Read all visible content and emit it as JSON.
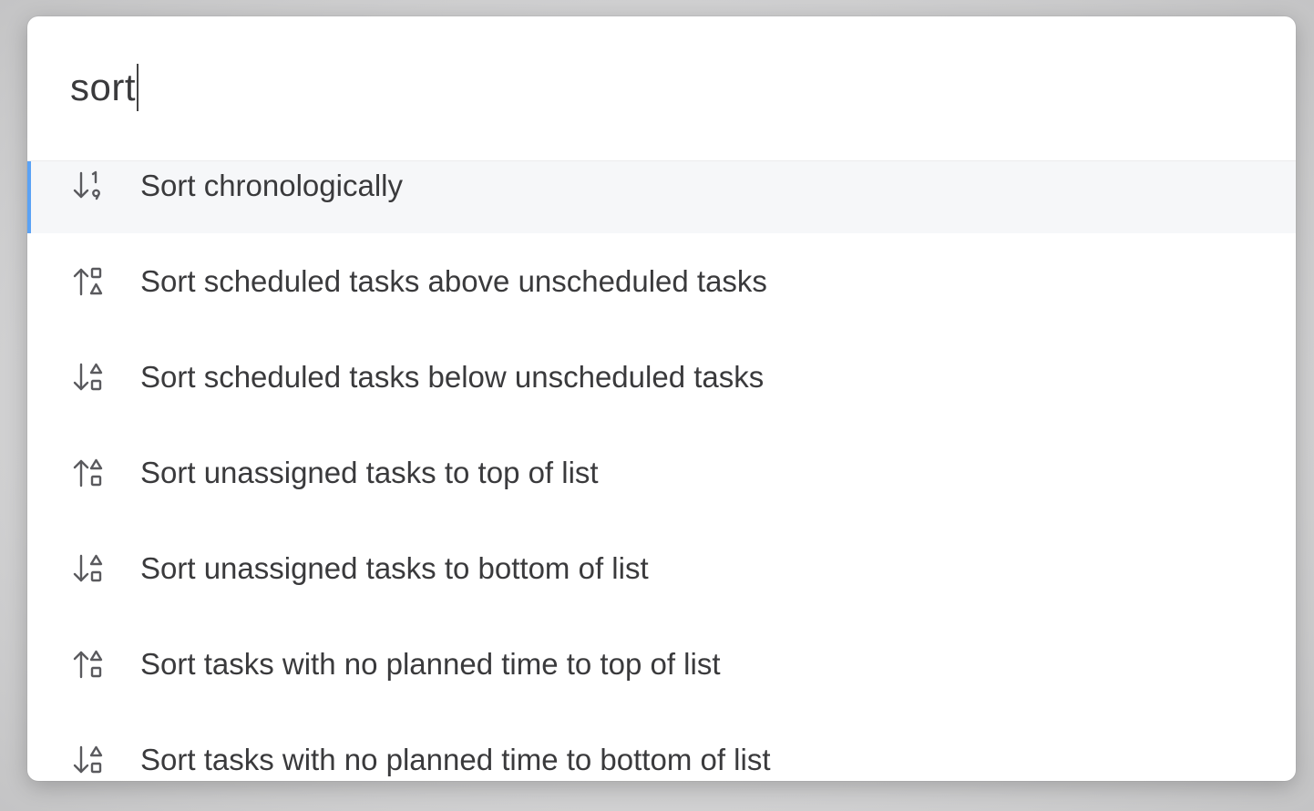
{
  "search": {
    "value": "sort"
  },
  "results": [
    {
      "label": "Sort chronologically",
      "icon": "sort-chronological-icon"
    },
    {
      "label": "Sort scheduled tasks above unscheduled tasks",
      "icon": "sort-up-shapes-icon"
    },
    {
      "label": "Sort scheduled tasks below unscheduled tasks",
      "icon": "sort-down-shapes-icon"
    },
    {
      "label": "Sort unassigned tasks to top of list",
      "icon": "sort-up-shapes-icon"
    },
    {
      "label": "Sort unassigned tasks to bottom of list",
      "icon": "sort-down-shapes-icon"
    },
    {
      "label": "Sort tasks with no planned time to top of list",
      "icon": "sort-up-shapes-icon"
    },
    {
      "label": "Sort tasks with no planned time to bottom of list",
      "icon": "sort-down-shapes-icon"
    }
  ],
  "colors": {
    "accent": "#5aa2f5",
    "selected_bg": "#f6f7f9",
    "text": "#3a3a3c",
    "icon": "#5a5a5e"
  }
}
